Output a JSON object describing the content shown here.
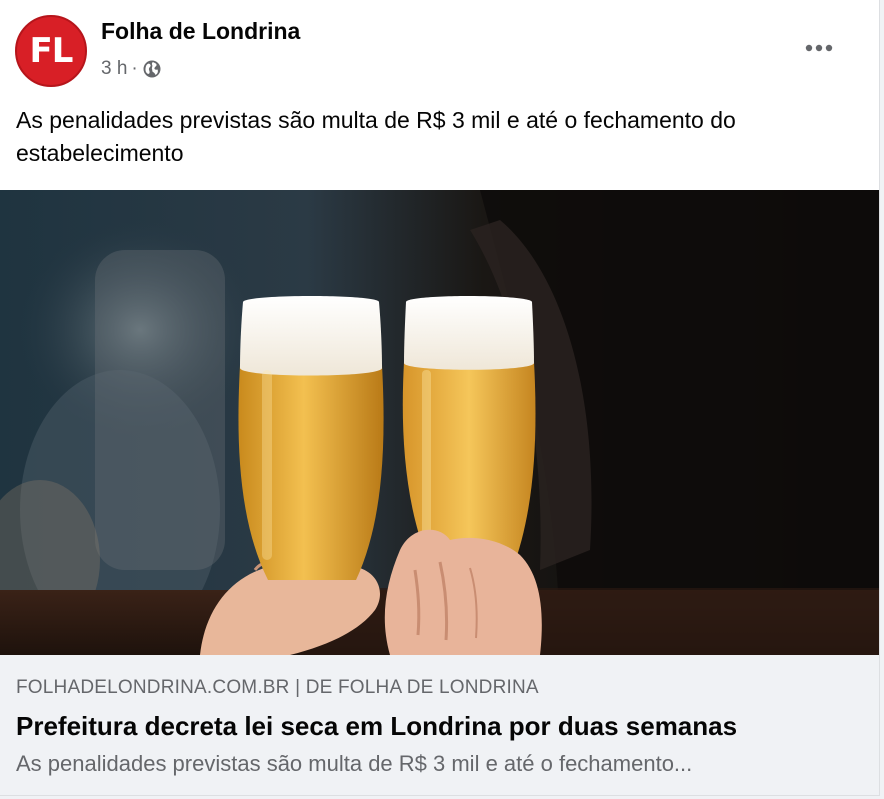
{
  "post": {
    "page_name": "Folha de Londrina",
    "avatar_text": "FL",
    "time": "3 h",
    "separator": "·",
    "privacy_icon": "globe-icon",
    "more_icon": "ellipsis-icon",
    "text": "As penalidades previstas são multa de R$ 3 mil e até o fechamento do estabelecimento"
  },
  "link_preview": {
    "domain_line": "FOLHADELONDRINA.COM.BR | DE FOLHA DE LONDRINA",
    "title": "Prefeitura decreta lei seca em Londrina por duas semanas",
    "description": "As penalidades previstas são multa de R$ 3 mil e até o fechamento..."
  },
  "colors": {
    "brand_red": "#d81f26",
    "text_primary": "#050505",
    "text_secondary": "#65676b",
    "preview_bg": "#f0f2f5"
  }
}
